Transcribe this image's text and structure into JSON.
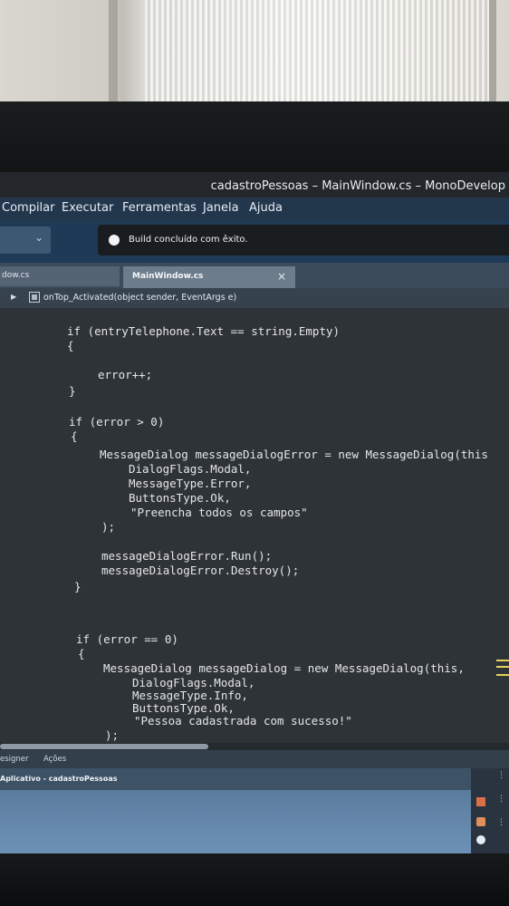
{
  "window": {
    "title": "cadastroPessoas – MainWindow.cs – MonoDevelop"
  },
  "menu": {
    "items": [
      "Compilar",
      "Executar",
      "Ferramentas",
      "Janela",
      "Ajuda"
    ]
  },
  "status": {
    "text": "Build concluído com êxito."
  },
  "tabs": {
    "inactive": "dow.cs",
    "active": "MainWindow.cs",
    "close_glyph": "×"
  },
  "breadcrumb": {
    "signature": "onTop_Activated(object sender, EventArgs e)"
  },
  "code": {
    "lines": [
      "if (entryTelephone.Text == string.Empty)",
      "{",
      "error++;",
      "}",
      "if (error > 0)",
      "{",
      "MessageDialog messageDialogError = new MessageDialog(this",
      "DialogFlags.Modal,",
      "MessageType.Error,",
      "ButtonsType.Ok,",
      "\"Preencha todos os campos\"",
      ");",
      "messageDialogError.Run();",
      "messageDialogError.Destroy();",
      "}",
      "if (error == 0)",
      "{",
      "MessageDialog messageDialog = new MessageDialog(this,",
      "DialogFlags.Modal,",
      "MessageType.Info,",
      "ButtonsType.Ok,",
      "\"Pessoa cadastrada com sucesso!\"",
      ");"
    ]
  },
  "view_tabs": {
    "designer": "esigner",
    "actions": "Ações"
  },
  "pad": {
    "title": "Aplicativo - cadastroPessoas"
  },
  "colors": {
    "menubar": "#22364c",
    "toolbar": "#1e3a56",
    "editor_bg": "#2e3338",
    "keyword": "#9fc3ec"
  }
}
